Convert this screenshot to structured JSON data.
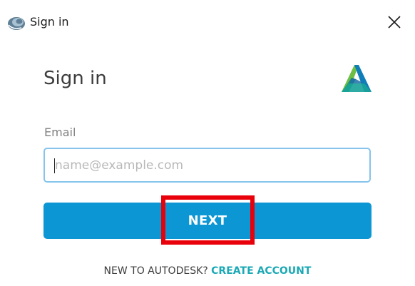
{
  "window": {
    "title": "Sign in",
    "icon": "autodesk-app-icon",
    "close_icon": "close-icon"
  },
  "form": {
    "heading": "Sign in",
    "logo": "autodesk-logo",
    "email_label": "Email",
    "email_placeholder": "name@example.com",
    "email_value": "",
    "next_label": "NEXT"
  },
  "footer": {
    "prompt_text": "NEW TO AUTODESK?",
    "create_account_label": "CREATE ACCOUNT"
  },
  "colors": {
    "primary_button": "#0c96d3",
    "link": "#1ba9b5",
    "input_border_focus": "#86c4ec",
    "highlight_box": "#e8000a"
  }
}
